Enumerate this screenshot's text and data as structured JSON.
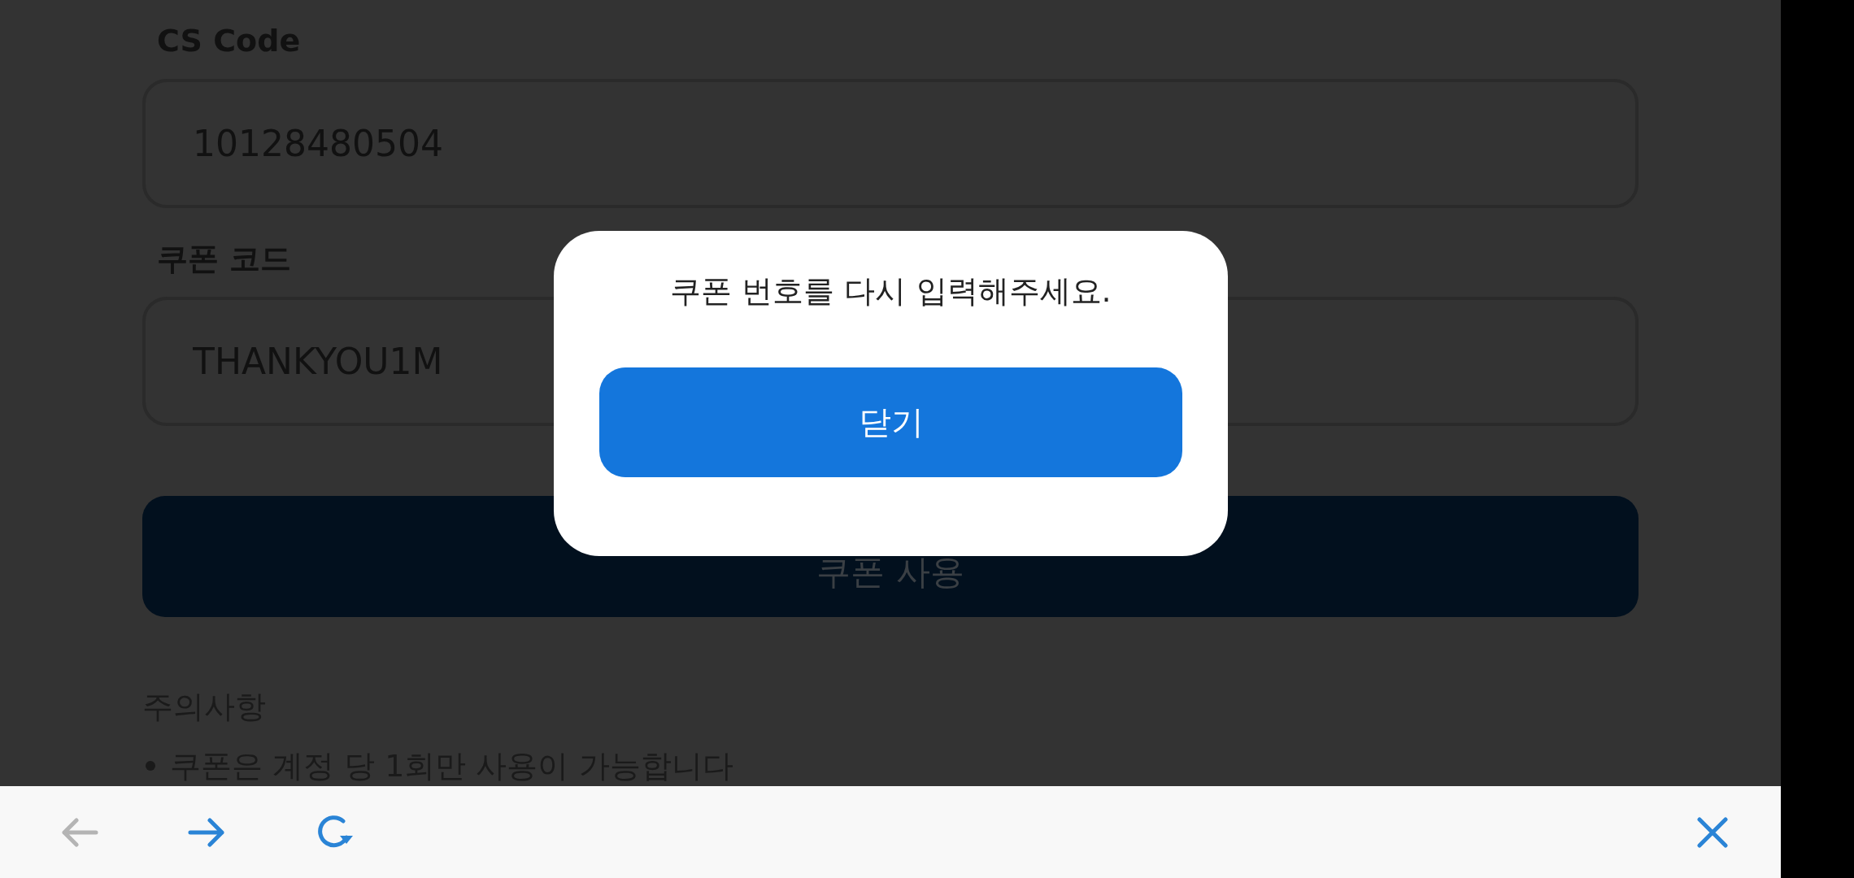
{
  "form": {
    "fields": [
      {
        "label": "CS Code",
        "value": "10128480504"
      },
      {
        "label": "쿠폰 코드",
        "value": "THANKYOU1M"
      }
    ],
    "submit_button": "쿠폰 사용",
    "notice_title": "주의사항",
    "notices": [
      "쿠폰은 계정 당 1회만 사용이 가능합니다"
    ]
  },
  "dialog": {
    "message": "쿠폰 번호를 다시 입력해주세요.",
    "button": "닫기"
  },
  "toolbar": {
    "buttons": [
      {
        "kind": "back",
        "disabled": true
      },
      {
        "kind": "forward",
        "disabled": false
      },
      {
        "kind": "reload",
        "disabled": false
      },
      {
        "kind": "close",
        "disabled": false
      }
    ]
  }
}
